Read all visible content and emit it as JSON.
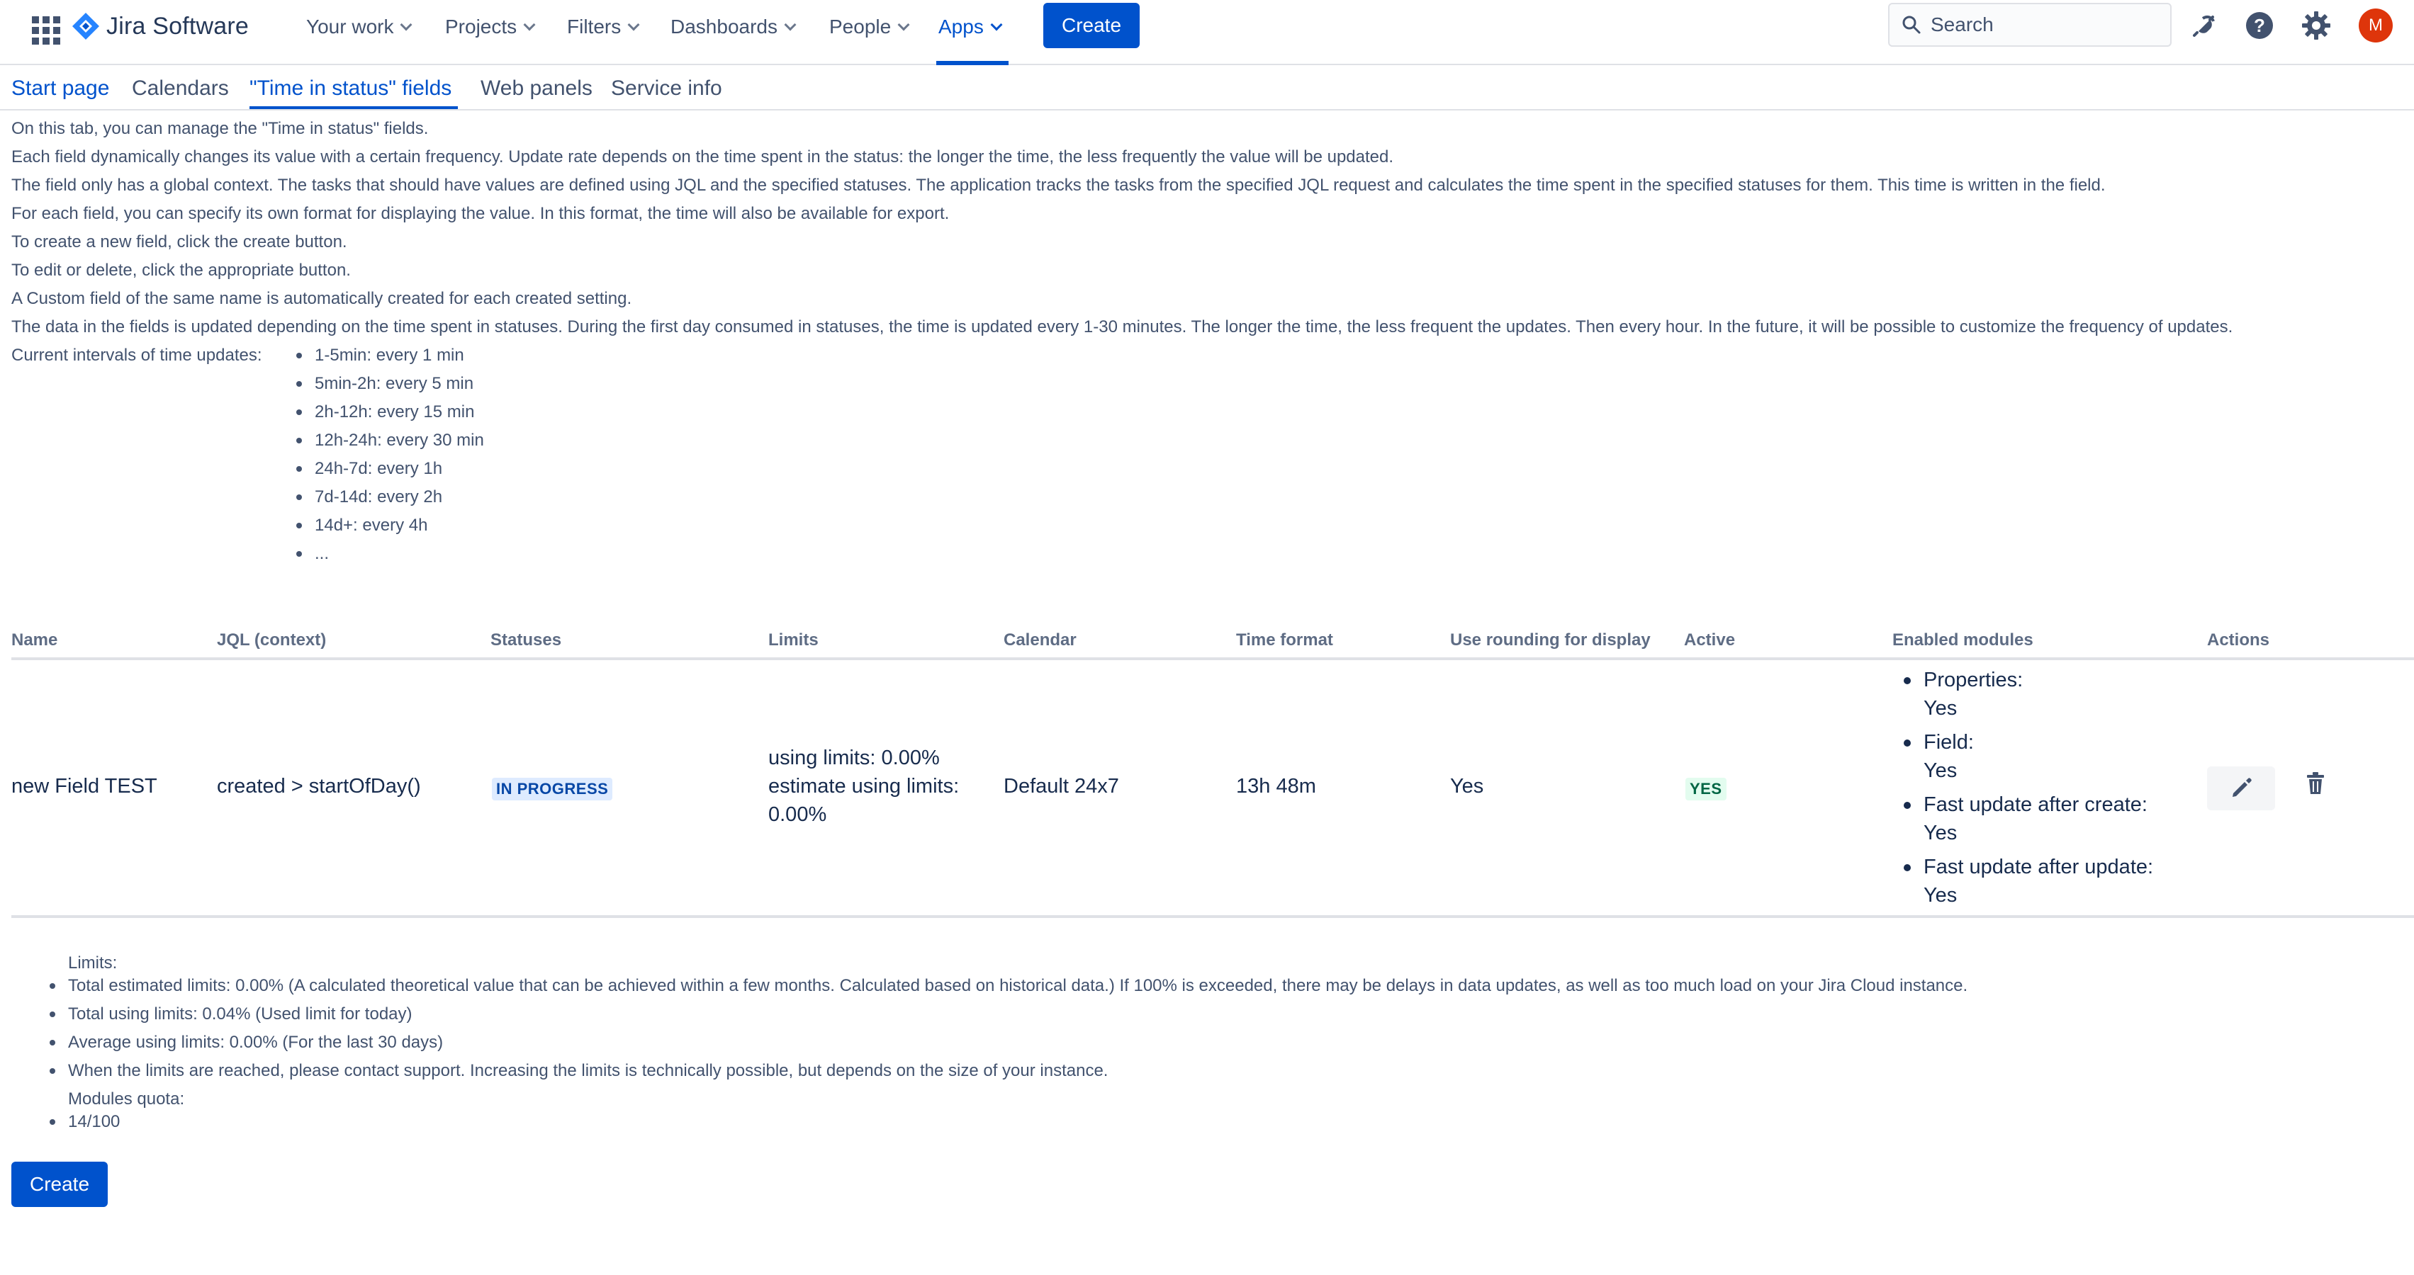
{
  "header": {
    "logo_text": "Jira Software",
    "nav": {
      "your_work": "Your work",
      "projects": "Projects",
      "filters": "Filters",
      "dashboards": "Dashboards",
      "people": "People",
      "apps": "Apps"
    },
    "create_label": "Create",
    "search_placeholder": "Search",
    "avatar_initial": "M",
    "accent_color": "#0052cc",
    "avatar_color": "#de350b"
  },
  "tabs": {
    "start_page": "Start page",
    "calendars": "Calendars",
    "time_in_status_fields": "\"Time in status\" fields",
    "web_panels": "Web panels",
    "service_info": "Service info"
  },
  "description": {
    "lines": [
      "On this tab, you can manage the \"Time in status\" fields.",
      "Each field dynamically changes its value with a certain frequency. Update rate depends on the time spent in the status: the longer the time, the less frequently the value will be updated.",
      "The field only has a global context. The tasks that should have values are defined using JQL and the specified statuses. The application tracks the tasks from the specified JQL request and calculates the time spent in the specified statuses for them. This time is written in the field.",
      "For each field, you can specify its own format for displaying the value. In this format, the time will also be available for export.",
      "To create a new field, click the create button.",
      "To edit or delete, click the appropriate button.",
      "A Custom field of the same name is automatically created for each created setting.",
      "The data in the fields is updated depending on the time spent in statuses. During the first day consumed in statuses, the time is updated every 1-30 minutes. The longer the time, the less frequent the updates. Then every hour. In the future, it will be possible to customize the frequency of updates."
    ],
    "intervals_label": "Current intervals of time updates:",
    "intervals": [
      "1-5min: every 1 min",
      "5min-2h: every 5 min",
      "2h-12h: every 15 min",
      "12h-24h: every 30 min",
      "24h-7d: every 1h",
      "7d-14d: every 2h",
      "14d+: every 4h",
      "..."
    ]
  },
  "table": {
    "headers": {
      "name": "Name",
      "jql": "JQL (context)",
      "statuses": "Statuses",
      "limits": "Limits",
      "calendar": "Calendar",
      "time_format": "Time format",
      "rounding": "Use rounding for display",
      "active": "Active",
      "modules": "Enabled modules",
      "actions": "Actions"
    },
    "rows": [
      {
        "name": "new Field TEST",
        "jql": "created > startOfDay()",
        "status": "IN PROGRESS",
        "limits_line1": "using limits: 0.00%",
        "limits_line2": "estimate using limits:",
        "limits_line3": "0.00%",
        "calendar": "Default 24x7",
        "time_format": "13h 48m",
        "rounding": "Yes",
        "active": "YES",
        "modules": [
          {
            "label": "Properties:",
            "value": "Yes"
          },
          {
            "label": "Field:",
            "value": "Yes"
          },
          {
            "label": "Fast update after create:",
            "value": "Yes"
          },
          {
            "label": "Fast update after update:",
            "value": "Yes"
          }
        ]
      }
    ]
  },
  "limits": {
    "label": "Limits:",
    "items": [
      "Total estimated limits: 0.00% (A calculated theoretical value that can be achieved within a few months. Calculated based on historical data.) If 100% is exceeded, there may be delays in data updates, as well as too much load on your Jira Cloud instance.",
      "Total using limits: 0.04% (Used limit for today)",
      "Average using limits: 0.00% (For the last 30 days)",
      "When the limits are reached, please contact support. Increasing the limits is technically possible, but depends on the size of your instance."
    ],
    "modules_label": "Modules quota:",
    "quota": "14/100"
  },
  "footer": {
    "create_label": "Create"
  }
}
